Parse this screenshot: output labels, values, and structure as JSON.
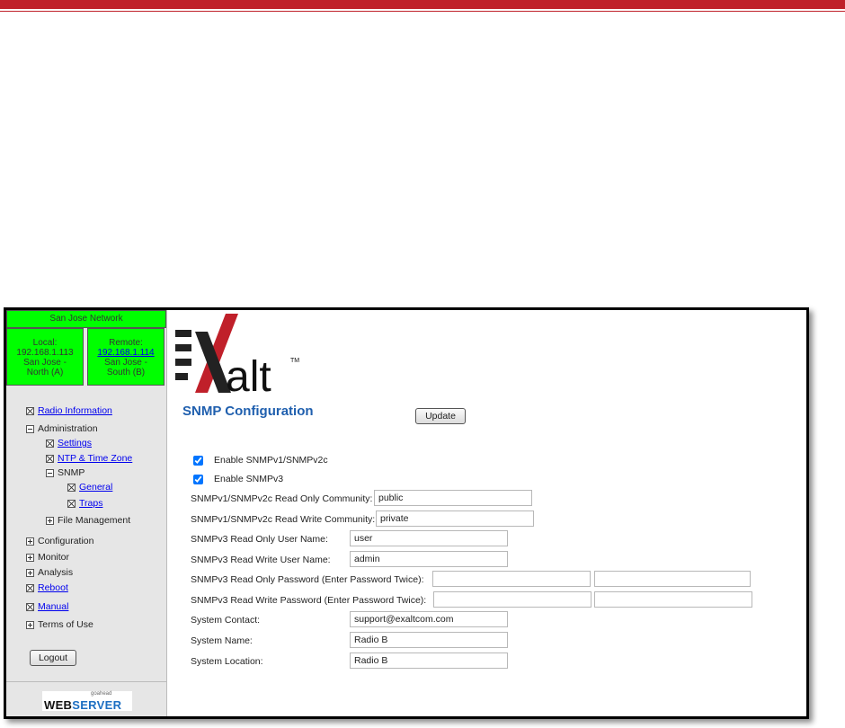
{
  "network": {
    "name": "San Jose Network",
    "local": {
      "label": "Local:",
      "ip": "192.168.1.113",
      "site": "San Jose -",
      "side": "North (A)"
    },
    "remote": {
      "label": "Remote:",
      "ip": "192.168.1.114",
      "site": "San Jose -",
      "side": "South (B)"
    }
  },
  "nav": {
    "radio_information": "Radio Information",
    "administration": "Administration",
    "settings": "Settings",
    "ntp": "NTP & Time Zone",
    "snmp": "SNMP",
    "general": "General",
    "traps": "Traps",
    "file_management": "File Management",
    "configuration": "Configuration",
    "monitor": "Monitor",
    "analysis": "Analysis",
    "reboot": "Reboot",
    "manual": "Manual",
    "terms": "Terms of Use"
  },
  "logout_label": "Logout",
  "webserver": {
    "small": "goahead",
    "web": "WEB",
    "server": "SERVER"
  },
  "logo_text": "alt",
  "logo_tm": "TM",
  "page_title": "SNMP Configuration",
  "update_label": "Update",
  "form": {
    "enable_v1v2c": {
      "label": "Enable SNMPv1/SNMPv2c",
      "checked": true
    },
    "enable_v3": {
      "label": "Enable SNMPv3",
      "checked": true
    },
    "ro_community": {
      "label": "SNMPv1/SNMPv2c Read Only Community:",
      "value": "public"
    },
    "rw_community": {
      "label": "SNMPv1/SNMPv2c Read Write Community:",
      "value": "private"
    },
    "v3_ro_user": {
      "label": "SNMPv3 Read Only User Name:",
      "value": "user"
    },
    "v3_rw_user": {
      "label": "SNMPv3 Read Write User Name:",
      "value": "admin"
    },
    "v3_ro_password": {
      "label": "SNMPv3 Read Only Password (Enter Password Twice):",
      "value": "",
      "confirm": ""
    },
    "v3_rw_password": {
      "label": "SNMPv3 Read Write Password (Enter Password Twice):",
      "value": "",
      "confirm": ""
    },
    "system_contact": {
      "label": "System Contact:",
      "value": "support@exaltcom.com"
    },
    "system_name": {
      "label": "System Name:",
      "value": "Radio B"
    },
    "system_location": {
      "label": "System Location:",
      "value": "Radio B"
    }
  },
  "colors": {
    "accent_bar": "#c0202a",
    "status_green": "#00ff00",
    "title_blue": "#1f5fae",
    "link": "#0000ee"
  }
}
